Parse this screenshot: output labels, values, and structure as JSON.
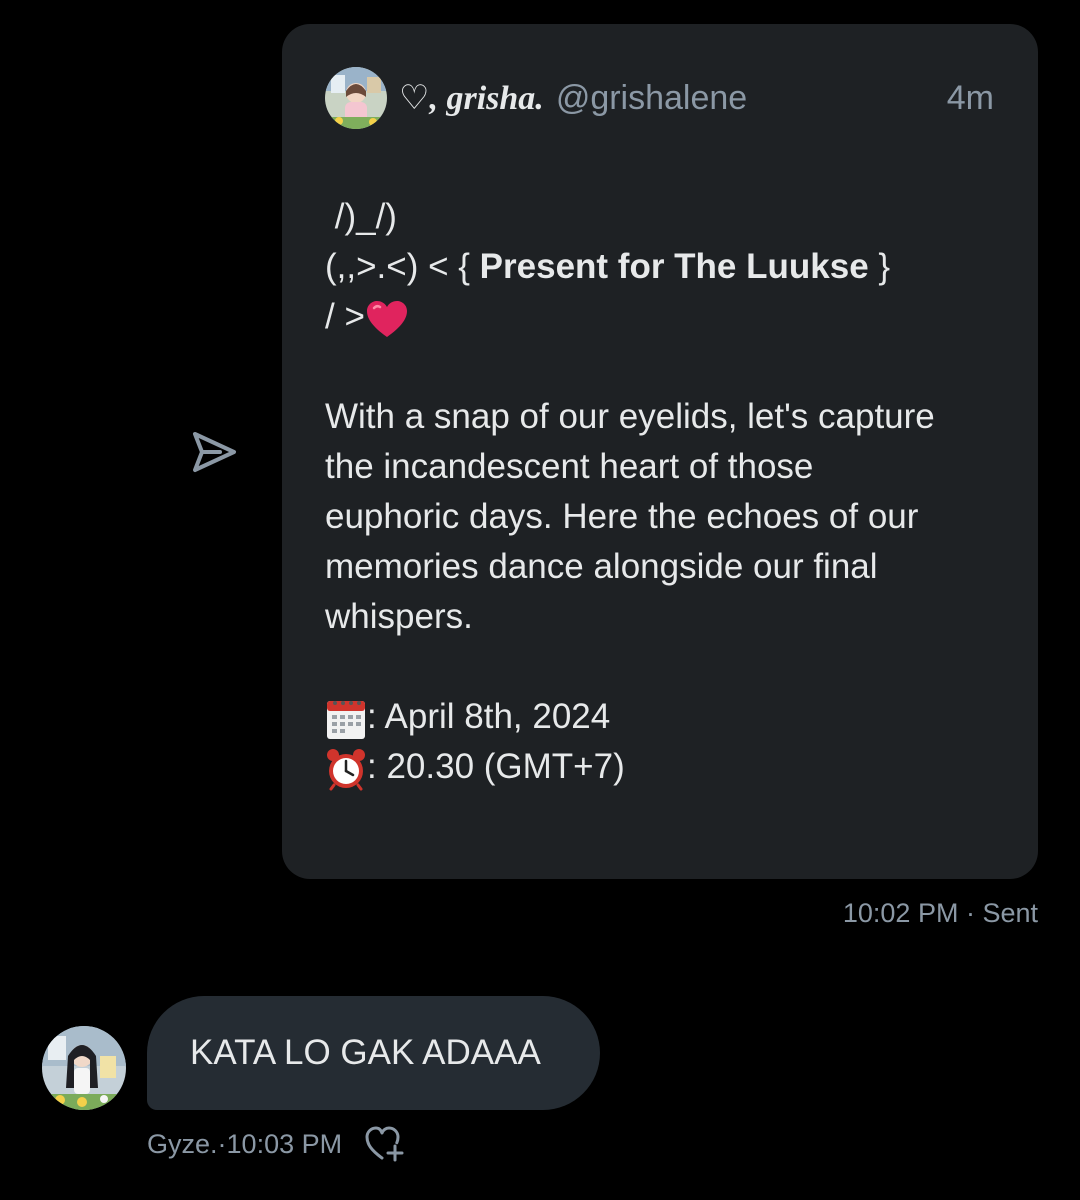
{
  "colors": {
    "background": "#000000",
    "card_background": "#1e2124",
    "bubble_background": "#252c33",
    "primary_text": "#e7e9ea",
    "secondary_text": "#8b98a5",
    "heart": "#e0245e"
  },
  "shared_post": {
    "author_name": "♡, grisha.",
    "author_handle": "@grishalene",
    "time": "4m",
    "kaomoji_line1": " /)_/)",
    "kaomoji_line2_prefix": "(,,>.<) < { ",
    "kaomoji_line2_bold": "Present for The Luukse",
    "kaomoji_line2_suffix": " }",
    "kaomoji_line3": "/ >",
    "heart_emoji": "heart-emoji",
    "paragraph_lines": [
      "With a snap of our eyelids, let's capture",
      "the incandescent heart of those",
      "euphoric days. Here the echoes of our",
      "memories dance alongside our final",
      "whispers."
    ],
    "date_icon": "calendar-icon",
    "date_text": ": April 8th, 2024",
    "time_icon": "alarm-clock-icon",
    "time_text": ": 20.30 (GMT+7)"
  },
  "sent_meta": {
    "timestamp": "10:02 PM",
    "separator": " · ",
    "status": "Sent"
  },
  "received_message": {
    "text": "KATA LO GAK ADAAA",
    "sender": "Gyze.",
    "separator": " · ",
    "timestamp": "10:03 PM",
    "react_icon": "heart-plus-icon"
  },
  "share_icon": "send-icon"
}
